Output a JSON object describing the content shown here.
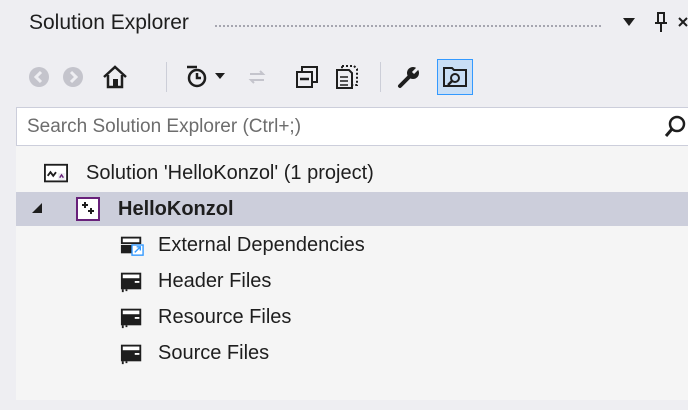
{
  "panel": {
    "title": "Solution Explorer",
    "dropdown_glyph": "▼",
    "pin_glyph": "ꟸ"
  },
  "toolbar": {
    "buttons": [
      {
        "name": "back-button",
        "icon": "circle-arrow-left-icon"
      },
      {
        "name": "forward-button",
        "icon": "circle-arrow-right-icon"
      },
      {
        "name": "home-button",
        "icon": "home-icon"
      },
      {
        "name": "pending-changes-filter-button",
        "icon": "clock-icon"
      },
      {
        "name": "sync-button",
        "icon": "sync-icon"
      },
      {
        "name": "collapse-all-button",
        "icon": "collapse-all-icon"
      },
      {
        "name": "show-all-files-button",
        "icon": "show-all-files-icon"
      },
      {
        "name": "properties-button",
        "icon": "wrench-icon"
      },
      {
        "name": "preview-selected-items-button",
        "icon": "preview-icon",
        "active": true
      }
    ]
  },
  "search": {
    "placeholder": "Search Solution Explorer (Ctrl+;)",
    "value": ""
  },
  "tree": {
    "solution_label": "Solution 'HelloKonzol' (1 project)",
    "project_label": "HelloKonzol",
    "expander_glyph": "◢",
    "folders": [
      {
        "label": "External Dependencies",
        "icon": "external-dependencies-icon"
      },
      {
        "label": "Header Files",
        "icon": "filter-folder-icon"
      },
      {
        "label": "Resource Files",
        "icon": "filter-folder-icon"
      },
      {
        "label": "Source Files",
        "icon": "filter-folder-icon"
      }
    ]
  },
  "colors": {
    "background": "#eeeef2",
    "tree_background": "#f5f5f5",
    "selected_row": "#cccedb",
    "active_button": "#c9def5",
    "accent": "#3399ff",
    "project_icon": "#68217a"
  }
}
